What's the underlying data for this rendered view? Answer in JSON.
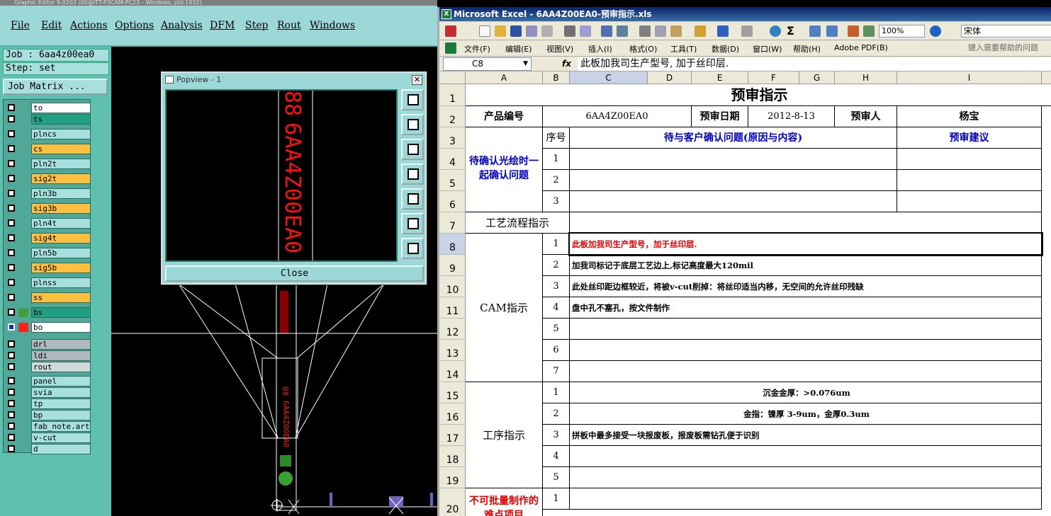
{
  "graphic_editor": {
    "title": "Graphic Editor 9.0202 (00@ITT-P3CAM-PC23 - Windows, pid:1932)",
    "menu": [
      "File",
      "Edit",
      "Actions",
      "Options",
      "Analysis",
      "DFM",
      "Step",
      "Rout",
      "Windows"
    ],
    "job_label": "Job : 6aa4z00ea0",
    "step_label": "Step: set",
    "job_matrix_button": "Job Matrix ...",
    "layers": [
      {
        "name": "to",
        "color": "#ffffff",
        "swatch": ""
      },
      {
        "name": "ts",
        "color": "#20a080",
        "swatch": ""
      },
      {
        "name": "plncs",
        "color": "#a8e0e0",
        "swatch": ""
      },
      {
        "name": "cs",
        "color": "#ffc040",
        "swatch": ""
      },
      {
        "name": "pln2t",
        "color": "#a8e0e0",
        "swatch": ""
      },
      {
        "name": "sig2t",
        "color": "#ffc040",
        "swatch": ""
      },
      {
        "name": "pln3b",
        "color": "#a8e0e0",
        "swatch": ""
      },
      {
        "name": "sig3b",
        "color": "#ffc040",
        "swatch": ""
      },
      {
        "name": "pln4t",
        "color": "#a8e0e0",
        "swatch": ""
      },
      {
        "name": "sig4t",
        "color": "#ffc040",
        "swatch": ""
      },
      {
        "name": "pln5b",
        "color": "#a8e0e0",
        "swatch": ""
      },
      {
        "name": "sig5b",
        "color": "#ffc040",
        "swatch": ""
      },
      {
        "name": "plnss",
        "color": "#a8e0e0",
        "swatch": ""
      },
      {
        "name": "ss",
        "color": "#ffc040",
        "swatch": ""
      },
      {
        "name": "bs",
        "color": "#20a080",
        "swatch": "#40a040"
      },
      {
        "name": "bo",
        "color": "#ffffff",
        "swatch": "#ff2020"
      },
      {
        "name": "drl",
        "color": "#b0b8c0",
        "swatch": ""
      },
      {
        "name": "ldi",
        "color": "#b0b8c0",
        "swatch": ""
      },
      {
        "name": "rout",
        "color": "#d0d8d8",
        "swatch": ""
      },
      {
        "name": "panel",
        "color": "#a8e0e0",
        "swatch": ""
      },
      {
        "name": "svia",
        "color": "#a8e0e0",
        "swatch": ""
      },
      {
        "name": "tp",
        "color": "#a8e0e0",
        "swatch": ""
      },
      {
        "name": "bp",
        "color": "#a8e0e0",
        "swatch": ""
      },
      {
        "name": "fab_note.art",
        "color": "#a8e0e0",
        "swatch": ""
      },
      {
        "name": "v-cut",
        "color": "#a8e0e0",
        "swatch": ""
      },
      {
        "name": "d",
        "color": "#a8e0e0",
        "swatch": ""
      }
    ],
    "popview": {
      "title": "Popview - 1",
      "close_button": "Close",
      "pcb_text": "6AA4Z00EA0",
      "tools": [
        "zoom-fit-icon",
        "pan-up-icon",
        "pan-down-icon",
        "pan-left-icon",
        "pan-right-icon",
        "zoom-in-icon",
        "zoom-out-icon"
      ]
    }
  },
  "excel": {
    "title": "Microsoft Excel - 6AA4Z00EA0-预审指示.xls",
    "zoom": "100%",
    "font": "宋体",
    "menu": [
      "文件(F)",
      "编辑(E)",
      "视图(V)",
      "插入(I)",
      "格式(O)",
      "工具(T)",
      "数据(D)",
      "窗口(W)",
      "帮助(H)",
      "Adobe PDF(B)"
    ],
    "help_placeholder": "键入需要帮助的问题",
    "name_box": "C8",
    "formula": "此板加我司生产型号, 加于丝印层.",
    "columns": [
      "A",
      "B",
      "C",
      "D",
      "E",
      "F",
      "G",
      "H",
      "I"
    ],
    "rows": [
      "1",
      "2",
      "3",
      "4",
      "5",
      "6",
      "7",
      "8",
      "9",
      "10",
      "11",
      "12",
      "13",
      "14",
      "15",
      "16",
      "17",
      "18",
      "19",
      "20"
    ],
    "sheet": {
      "title": "预审指示",
      "product_no_label": "产品编号",
      "product_no": "6AA4Z00EA0",
      "review_date_label": "预审日期",
      "review_date": "2012-8-13",
      "reviewer_label": "预审人",
      "reviewer": "杨宝",
      "seq_label": "序号",
      "issue_header": "待与客户确认问题(原因与内容)",
      "suggest_header": "预审建议",
      "confirm_label": "待确认光绘时一起确认问题",
      "flow_label": "工艺流程指示",
      "cam_label": "CAM指示",
      "process_label": "工序指示",
      "difficult_label": "不可批量制作的难点项目",
      "seq_confirm": [
        "1",
        "2",
        "3"
      ],
      "cam_items": [
        {
          "no": "1",
          "text": "此板加我司生产型号，加于丝印层."
        },
        {
          "no": "2",
          "text": "加我司标记于底层工艺边上,标记高度最大120mil"
        },
        {
          "no": "3",
          "text": "此处丝印距边框较近，将被v-cut削掉：将丝印适当内移，无空间的允许丝印残缺"
        },
        {
          "no": "4",
          "text": "盘中孔不塞孔，按文件制作"
        },
        {
          "no": "5",
          "text": ""
        },
        {
          "no": "6",
          "text": ""
        },
        {
          "no": "7",
          "text": ""
        }
      ],
      "process_items": [
        {
          "no": "1",
          "text": "沉金金厚：>0.076um"
        },
        {
          "no": "2",
          "text": "金指：镍厚  3-9um，金厚0.3um"
        },
        {
          "no": "3",
          "text": "拼板中最多接受一块报废板，报废板需钻孔便于识别"
        },
        {
          "no": "4",
          "text": ""
        },
        {
          "no": "5",
          "text": ""
        }
      ],
      "difficult_items": [
        {
          "no": "1",
          "text": ""
        }
      ]
    }
  }
}
